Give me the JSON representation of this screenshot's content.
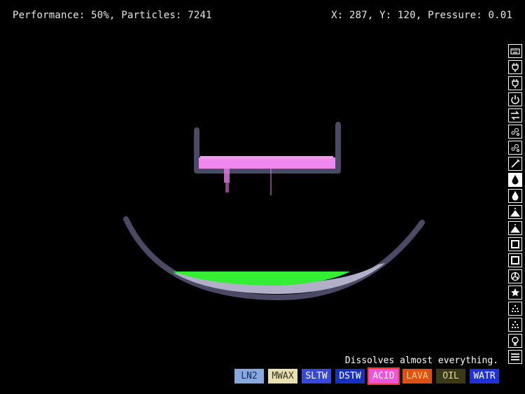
{
  "hud": {
    "left": "Performance: 50%, Particles: 7241",
    "right": "X: 287, Y: 120, Pressure: 0.01"
  },
  "description": "Dissolves almost everything.",
  "elements": [
    {
      "label": "LN2",
      "bg": "#87a8e0",
      "fg": "#1a2a55",
      "selected": false
    },
    {
      "label": "MWAX",
      "bg": "#e8e0b0",
      "fg": "#333322",
      "selected": false
    },
    {
      "label": "SLTW",
      "bg": "#3848d8",
      "fg": "#ffffff",
      "selected": false
    },
    {
      "label": "DSTW",
      "bg": "#1830c0",
      "fg": "#ffffff",
      "selected": false
    },
    {
      "label": "ACID",
      "bg": "#ee55dd",
      "fg": "#ffffff",
      "selected": true
    },
    {
      "label": "LAVA",
      "bg": "#e05010",
      "fg": "#ffcc88",
      "selected": false
    },
    {
      "label": "OIL",
      "bg": "#3a3a18",
      "fg": "#dddd99",
      "selected": false
    },
    {
      "label": "WATR",
      "bg": "#2030d8",
      "fg": "#ffffff",
      "selected": false
    }
  ],
  "tools": [
    {
      "name": "keyboard-icon",
      "selected": false
    },
    {
      "name": "plug-icon",
      "selected": false
    },
    {
      "name": "plug-icon",
      "selected": false
    },
    {
      "name": "power-icon",
      "selected": false
    },
    {
      "name": "arrows-icon",
      "selected": false
    },
    {
      "name": "gas-icon",
      "selected": false
    },
    {
      "name": "gas-icon",
      "selected": false
    },
    {
      "name": "wand-icon",
      "selected": false
    },
    {
      "name": "liquid-drop-icon",
      "selected": true
    },
    {
      "name": "drop-icon",
      "selected": false
    },
    {
      "name": "powder-icon",
      "selected": false
    },
    {
      "name": "powder-icon",
      "selected": false
    },
    {
      "name": "solid-icon",
      "selected": false
    },
    {
      "name": "solid-icon",
      "selected": false
    },
    {
      "name": "radiation-icon",
      "selected": false
    },
    {
      "name": "star-icon",
      "selected": false
    },
    {
      "name": "dots-icon",
      "selected": false
    },
    {
      "name": "dots-icon",
      "selected": false
    },
    {
      "name": "bulb-icon",
      "selected": false
    },
    {
      "name": "menu-icon",
      "selected": false
    }
  ]
}
